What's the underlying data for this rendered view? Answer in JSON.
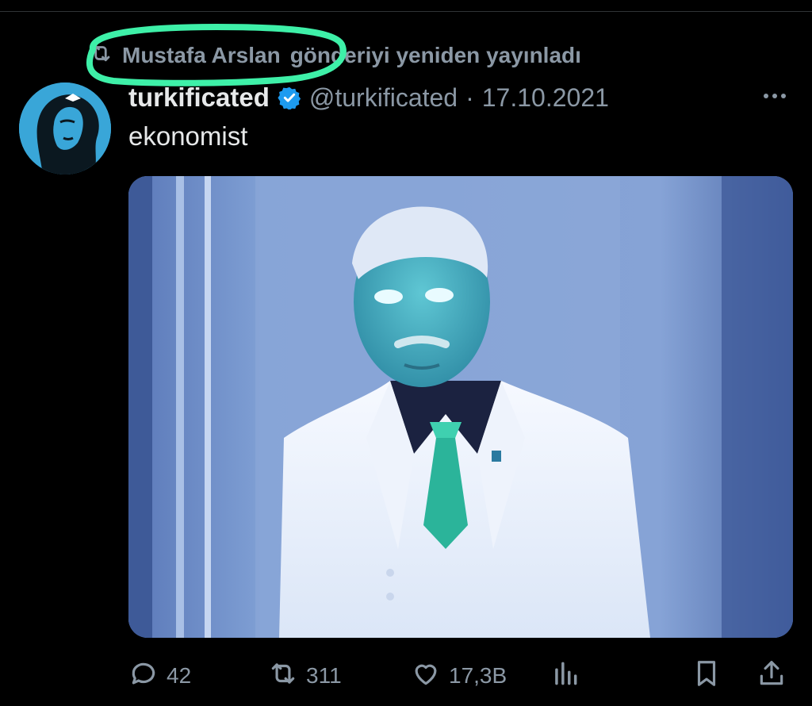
{
  "repost": {
    "icon": "repost-icon",
    "user": "Mustafa Arslan",
    "action": "gönderiyi yeniden yayınladı"
  },
  "author": {
    "avatar": "avatar-woman-silhouette",
    "display_name": "turkificated",
    "verified": true,
    "handle": "@turkificated",
    "separator": "·",
    "date": "17.10.2021"
  },
  "tweet": {
    "text": "ekonomist",
    "media": "inverted-colors-portrait-photo"
  },
  "metrics": {
    "replies": "42",
    "reposts": "311",
    "likes": "17,3B"
  },
  "icons": {
    "reply": "reply-icon",
    "repost": "repost-icon",
    "like": "heart-icon",
    "views": "bar-chart-icon",
    "bookmark": "bookmark-icon",
    "share": "share-icon",
    "more": "more-dots-icon"
  },
  "colors": {
    "background": "#000000",
    "text": "#e7e9ea",
    "muted": "#8b98a5",
    "verified": "#1d9bf0",
    "highlight": "#3ef0a8"
  }
}
